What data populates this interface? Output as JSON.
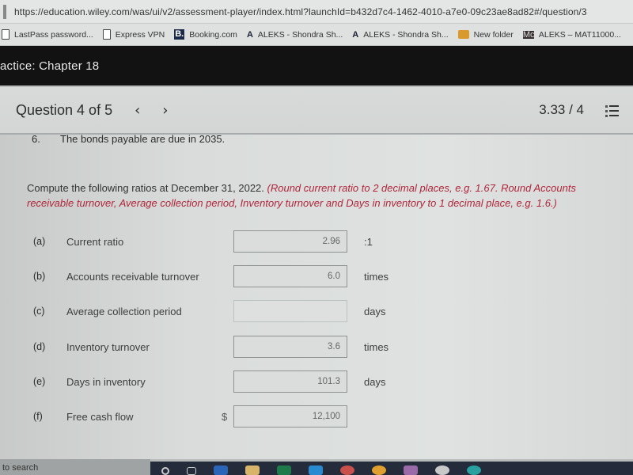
{
  "browser": {
    "url": "https://education.wiley.com/was/ui/v2/assessment-player/index.html?launchId=b432d7c4-1462-4010-a7e0-09c23ae8ad82#/question/3",
    "bookmarks": [
      {
        "label": "LastPass password...",
        "icon": "document-icon"
      },
      {
        "label": "Express VPN",
        "icon": "document-icon"
      },
      {
        "label": "Booking.com",
        "icon": "booking-icon"
      },
      {
        "label": "ALEKS - Shondra Sh...",
        "icon": "aleks-icon"
      },
      {
        "label": "ALEKS - Shondra Sh...",
        "icon": "aleks-icon"
      },
      {
        "label": "New folder",
        "icon": "folder-icon"
      },
      {
        "label": "ALEKS – MAT11000...",
        "icon": "mcgraw-hill-icon"
      }
    ]
  },
  "course": {
    "title": "actice: Chapter 18"
  },
  "question_header": {
    "label": "Question 4 of 5",
    "prev": "‹",
    "next": "›",
    "score": "3.33 / 4"
  },
  "content": {
    "note_number": "6.",
    "note_text": "The bonds payable are due in 2035.",
    "instruction": "Compute the following ratios at December 31, 2022.",
    "instruction_red": "(Round current ratio to 2 decimal places, e.g. 1.67. Round Accounts receivable turnover, Average collection period, Inventory turnover and Days in inventory to 1 decimal place, e.g. 1.6.)",
    "rows": [
      {
        "letter": "(a)",
        "label": "Current ratio",
        "prefix": "",
        "value": "2.96",
        "unit": ":1"
      },
      {
        "letter": "(b)",
        "label": "Accounts receivable turnover",
        "prefix": "",
        "value": "6.0",
        "unit": "times"
      },
      {
        "letter": "(c)",
        "label": "Average collection period",
        "prefix": "",
        "value": "",
        "unit": "days"
      },
      {
        "letter": "(d)",
        "label": "Inventory turnover",
        "prefix": "",
        "value": "3.6",
        "unit": "times"
      },
      {
        "letter": "(e)",
        "label": "Days in inventory",
        "prefix": "",
        "value": "101.3",
        "unit": "days"
      },
      {
        "letter": "(f)",
        "label": "Free cash flow",
        "prefix": "$",
        "value": "12,100",
        "unit": ""
      }
    ]
  },
  "taskbar": {
    "search_text": "to search"
  }
}
